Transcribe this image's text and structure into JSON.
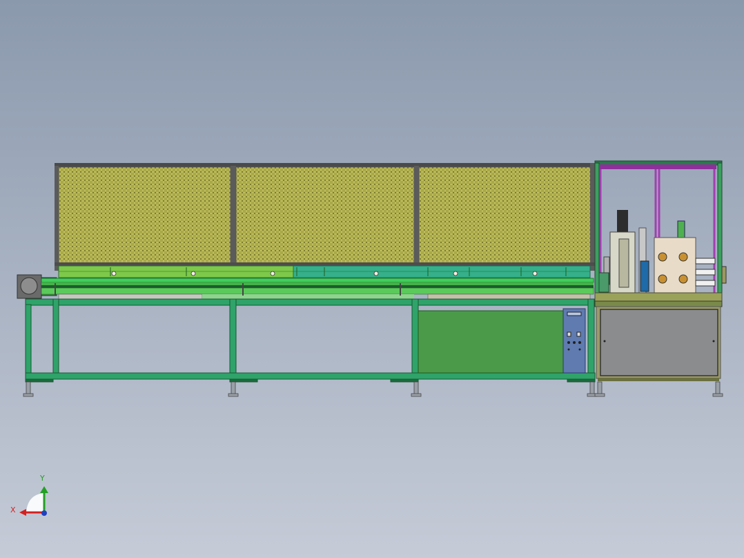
{
  "colors": {
    "bg_top": "#8c9aae",
    "bg_bottom": "#c4cad6",
    "frame_green": "#2fa060",
    "frame_green_dark": "#1e6b3e",
    "mesh_yellow": "#b8b84a",
    "belt_green": "#4fc94f",
    "panel_green": "#4a9a4a",
    "control_blue": "#5a7ab0",
    "cabinet_gray": "#8a8c8e",
    "guard_purple": "#9a3aa8",
    "axis_x": "#d42020",
    "axis_y": "#22a022",
    "axis_z": "#2040c0"
  },
  "triad": {
    "x_label": "X",
    "y_label": "Y",
    "icon": "coordinate-triad-icon"
  }
}
